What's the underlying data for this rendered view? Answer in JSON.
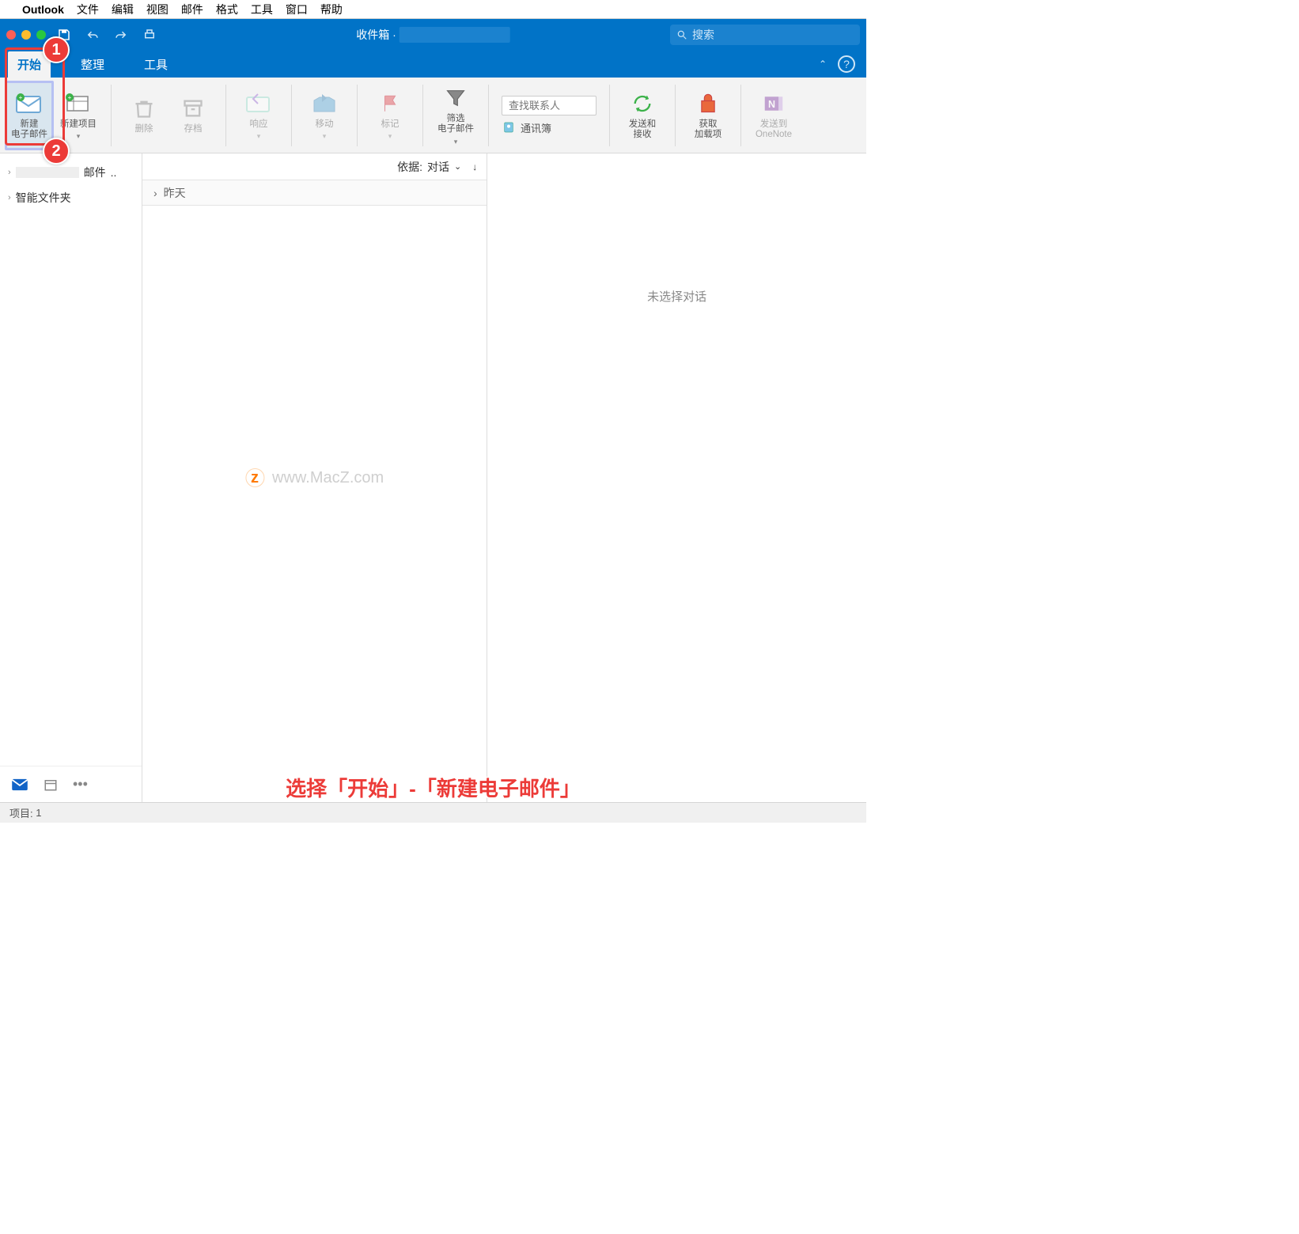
{
  "mac_menu": {
    "app": "Outlook",
    "items": [
      "文件",
      "编辑",
      "视图",
      "邮件",
      "格式",
      "工具",
      "窗口",
      "帮助"
    ]
  },
  "title_bar": {
    "title_prefix": "收件箱 ·",
    "search_placeholder": "搜索"
  },
  "tabs": {
    "home": "开始",
    "organize": "整理",
    "tools": "工具"
  },
  "ribbon": {
    "new_email": "新建\n电子邮件",
    "new_item": "新建项目",
    "delete": "删除",
    "archive": "存档",
    "respond": "响应",
    "move": "移动",
    "flag": "标记",
    "filter": "筛选\n电子邮件",
    "find_contacts_placeholder": "查找联系人",
    "address_book": "通讯簿",
    "send_receive": "发送和\n接收",
    "get_addins": "获取\n加载项",
    "send_onenote": "发送到\nOneNote"
  },
  "sidebar": {
    "row1_suffix": "邮件",
    "row1_trailing": "..",
    "smart_folders": "智能文件夹"
  },
  "list": {
    "sort_label": "依据:",
    "sort_value": "对话",
    "group_yesterday": "昨天"
  },
  "reading": {
    "empty": "未选择对话"
  },
  "watermark": "www.MacZ.com",
  "caption": "选择「开始」-「新建电子邮件」",
  "status": {
    "items_label": "项目:",
    "items_count": "1"
  },
  "badges": {
    "one": "1",
    "two": "2"
  }
}
